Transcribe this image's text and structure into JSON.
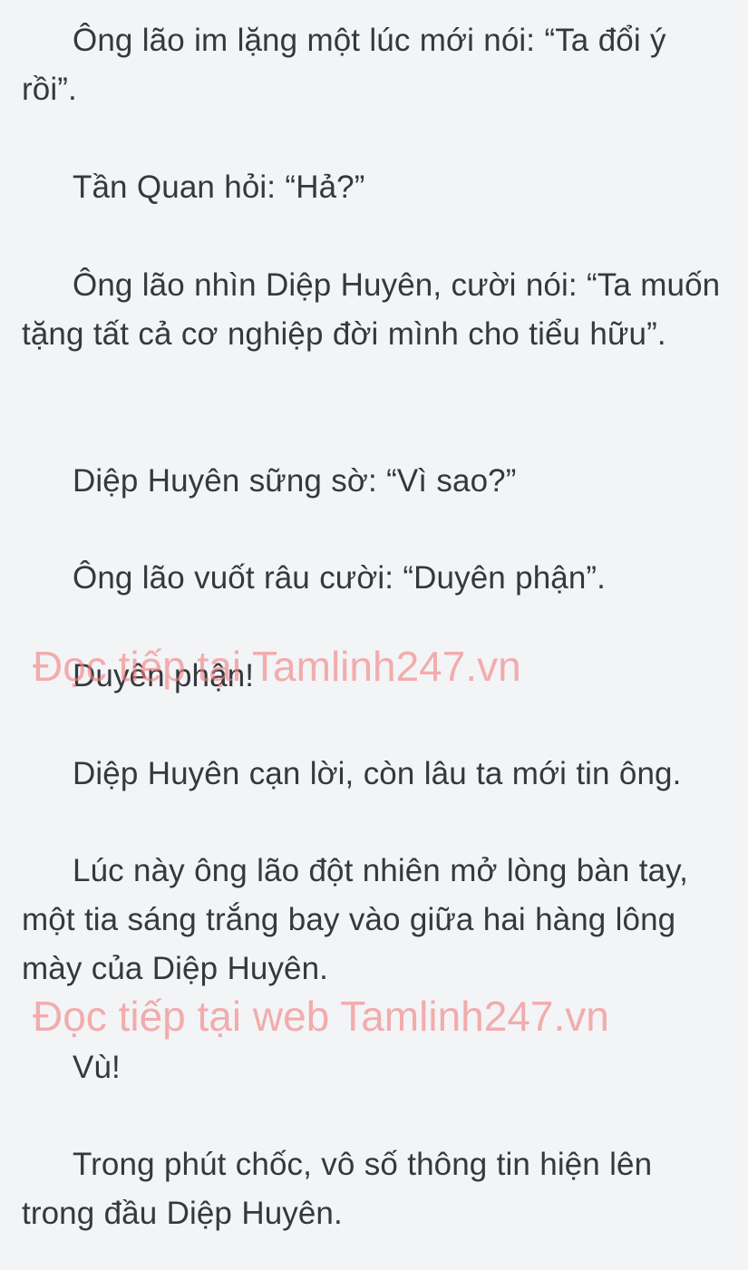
{
  "paragraphs": [
    "Ông lão im lặng một lúc mới nói: “Ta đổi ý rồi”.",
    "Tần Quan hỏi: “Hả?”",
    "Ông lão nhìn Diệp Huyên, cười nói: “Ta muốn tặng tất cả cơ nghiệp đời mình cho tiểu hữu”.",
    "Diệp Huyên sững sờ: “Vì sao?”",
    "Ông lão vuốt râu cười: “Duyên phận”.",
    "Duyên phận!",
    "Diệp Huyên cạn lời, còn lâu ta mới tin ông.",
    "Lúc này ông lão đột nhiên mở lòng bàn tay, một tia sáng trắng bay vào giữa hai hàng lông mày của Diệp Huyên.",
    "Vù!",
    "Trong phút chốc, vô số thông tin hiện lên trong đầu Diệp Huyên."
  ],
  "watermarks": [
    "Đọc tiếp tại Tamlinh247.vn",
    "Đọc tiếp tại web Tamlinh247.vn"
  ],
  "colors": {
    "background": "#f3f4f6",
    "text": "#35383d",
    "watermark": "#f08080"
  }
}
